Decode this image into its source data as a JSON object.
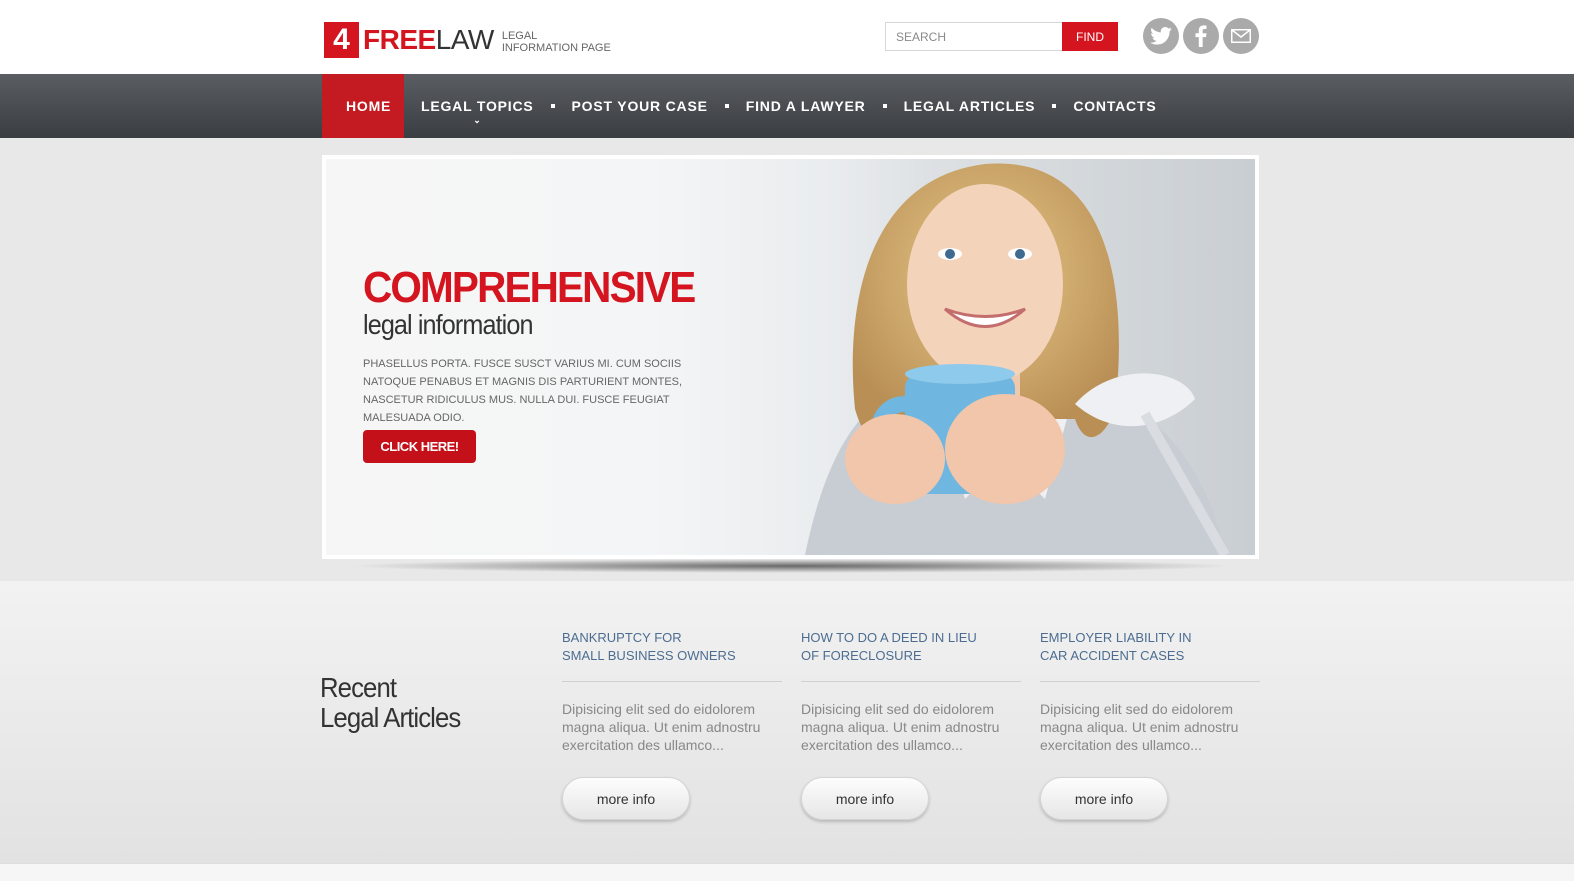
{
  "header": {
    "logo_number": "4",
    "logo_free": "FREE",
    "logo_law": "LAW",
    "tagline_line1": "LEGAL",
    "tagline_line2": "INFORMATION PAGE",
    "search_placeholder": "SEARCH",
    "search_button": "FIND",
    "social": [
      "twitter-icon",
      "facebook-icon",
      "mail-icon"
    ]
  },
  "nav": {
    "items": [
      {
        "label": "HOME",
        "active": true
      },
      {
        "label": "LEGAL TOPICS",
        "active": false,
        "has_submenu": true
      },
      {
        "label": "POST YOUR CASE",
        "active": false
      },
      {
        "label": "FIND A LAWYER",
        "active": false
      },
      {
        "label": "LEGAL ARTICLES",
        "active": false
      },
      {
        "label": "CONTACTS",
        "active": false
      }
    ]
  },
  "banner": {
    "title": "COMPREHENSIVE",
    "subtitle": "legal information",
    "text": "PHASELLUS PORTA. FUSCE SUSCT VARIUS MI. CUM SOCIIS NATOQUE PENABUS ET MAGNIS DIS PARTURIENT MONTES, NASCETUR RIDICULUS MUS. NULLA DUI. FUSCE FEUGIAT MALESUADA ODIO.",
    "button": "CLICK HERE!"
  },
  "articles": {
    "section_title_line1": "Recent",
    "section_title_line2": "Legal Articles",
    "items": [
      {
        "title_line1": "BANKRUPTCY FOR",
        "title_line2": "SMALL BUSINESS OWNERS",
        "text": "Dipisicing elit sed do eidolorem magna aliqua. Ut enim adnostru exercitation des ullamco...",
        "button": "more info"
      },
      {
        "title_line1": "HOW TO DO A DEED IN LIEU",
        "title_line2": "OF FORECLOSURE",
        "text": "Dipisicing elit sed do eidolorem magna aliqua. Ut enim adnostru exercitation des ullamco...",
        "button": "more info"
      },
      {
        "title_line1": "EMPLOYER LIABILITY IN",
        "title_line2": "CAR ACCIDENT CASES",
        "text": "Dipisicing elit sed do eidolorem magna aliqua. Ut enim adnostru exercitation des ullamco...",
        "button": "more info"
      }
    ]
  },
  "colors": {
    "brand_red": "#d4141f",
    "nav_dark": "#3a3d41",
    "article_link": "#4c6d91"
  }
}
